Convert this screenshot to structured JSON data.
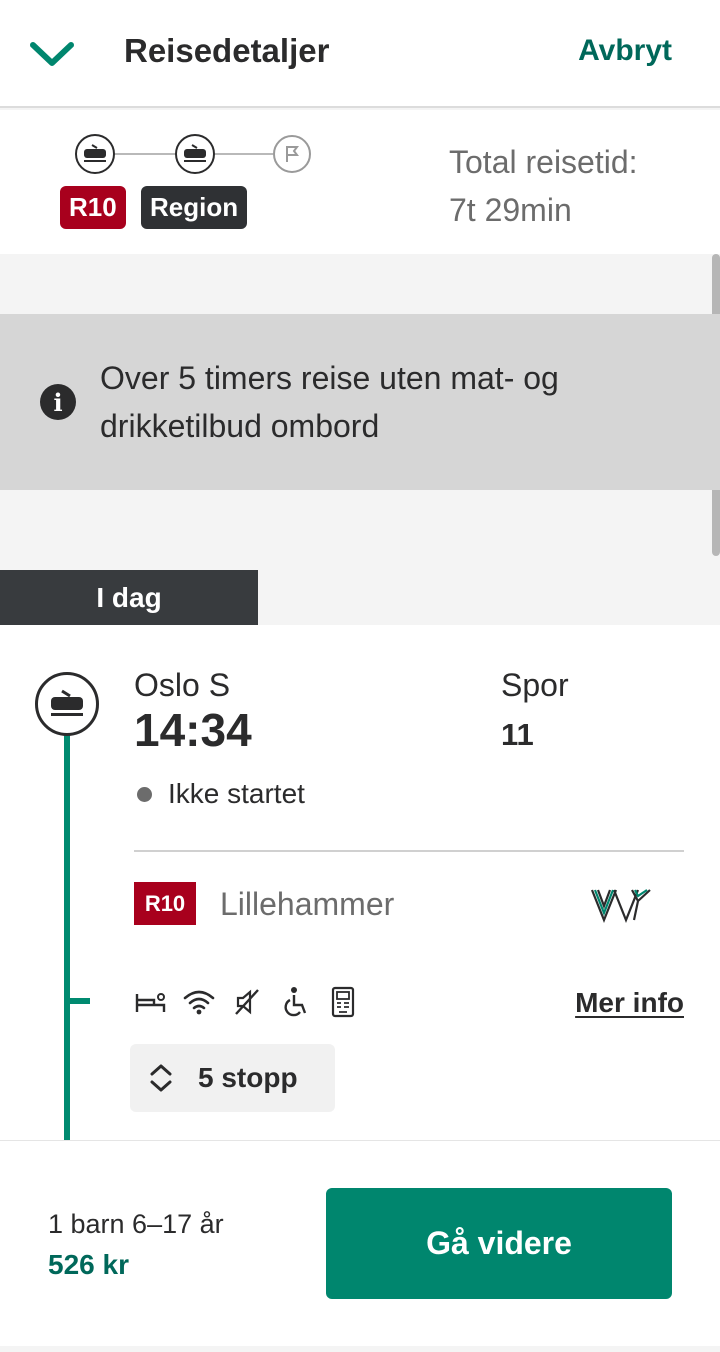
{
  "header": {
    "title": "Reisedetaljer",
    "cancel_label": "Avbryt",
    "back_icon": "chevron-down-icon"
  },
  "summary": {
    "legs": [
      {
        "badge": "R10",
        "color": "#a8001d"
      },
      {
        "badge": "Region",
        "color": "#2f3134"
      }
    ],
    "total_label": "Total reisetid:",
    "total_value": "7t 29min"
  },
  "notice": {
    "icon": "info-icon",
    "text": "Over 5 timers reise uten mat- og drikketilbud ombord"
  },
  "day_label": "I dag",
  "leg": {
    "station": "Oslo S",
    "departure_time": "14:34",
    "track_label": "Spor",
    "track_value": "11",
    "status": "Ikke startet",
    "line": "R10",
    "destination": "Lillehammer",
    "operator": "VY",
    "facilities": [
      "bed-icon",
      "wifi-icon",
      "quiet-zone-icon",
      "wheelchair-icon",
      "ticket-machine-icon"
    ],
    "more_info_label": "Mer info",
    "stops_label": "5 stopp"
  },
  "footer": {
    "passengers": "1 barn 6–17 år",
    "price": "526 kr",
    "continue_label": "Gå videre"
  },
  "colors": {
    "accent": "#00685a",
    "button": "#00866e",
    "r10": "#a8001d",
    "region": "#2f3134"
  }
}
